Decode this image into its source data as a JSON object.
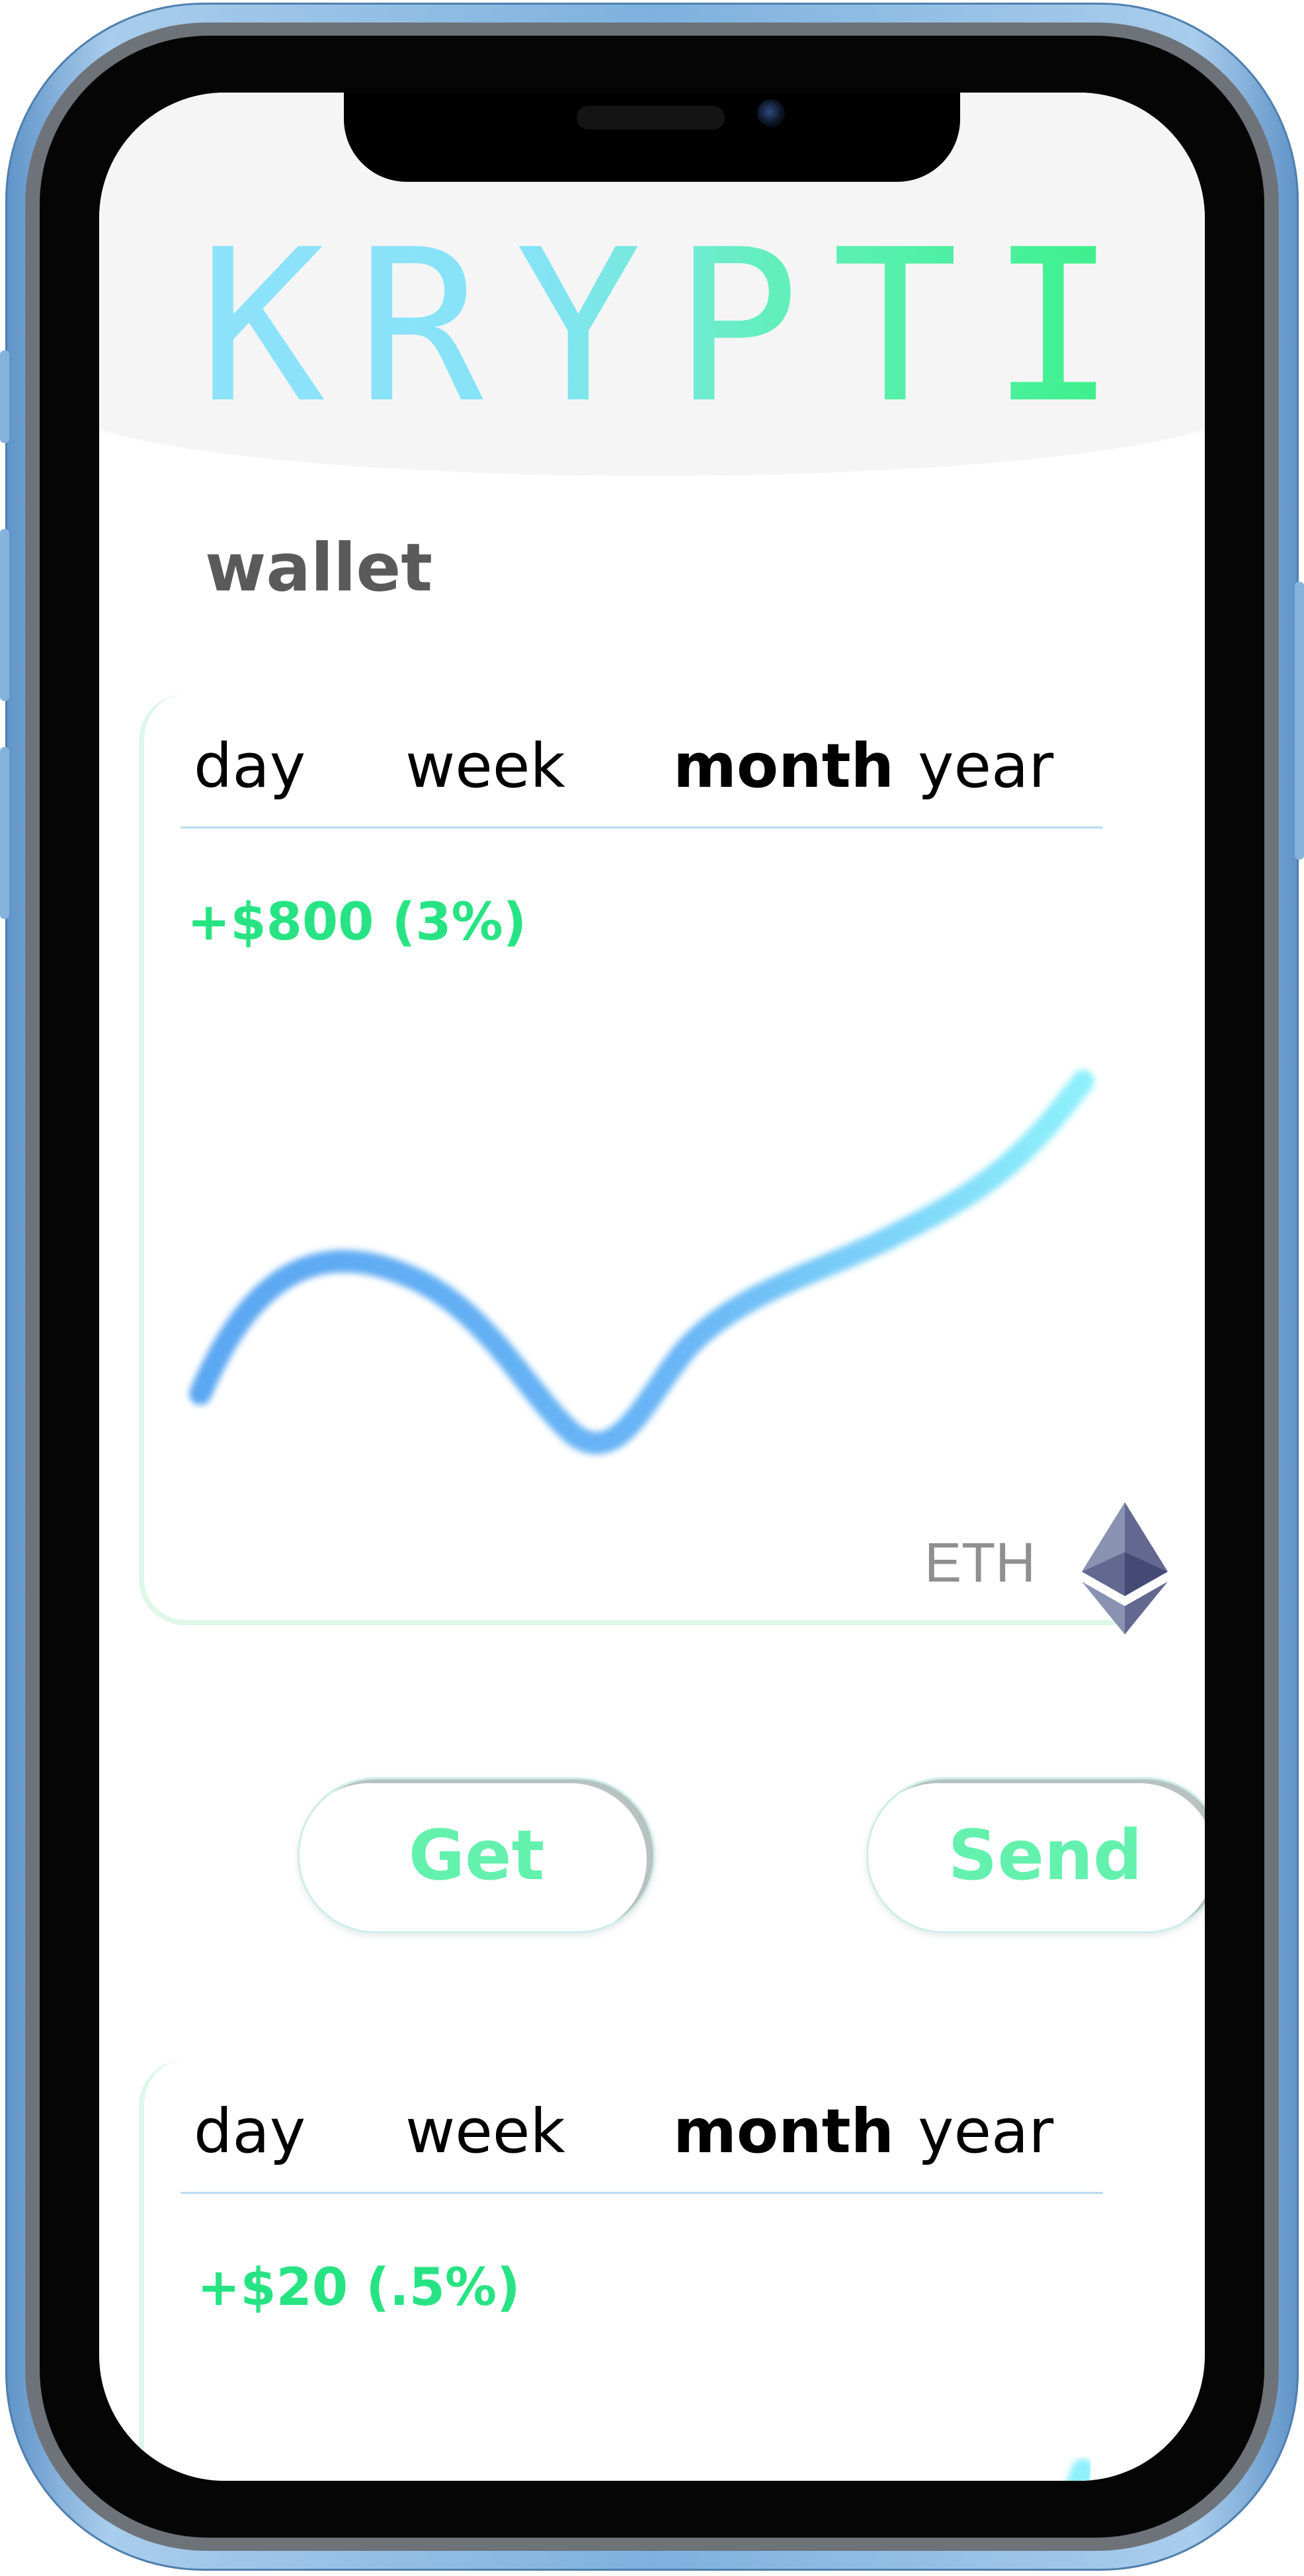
{
  "app": {
    "logo": "KRYPTIK",
    "section_title": "wallet"
  },
  "wallet_card": {
    "tabs": [
      {
        "label": "day",
        "active": false
      },
      {
        "label": "week",
        "active": false
      },
      {
        "label": "month",
        "active": true
      },
      {
        "label": "year",
        "active": false
      }
    ],
    "change": "+$800 (3%)",
    "asset_label": "ETH",
    "asset_icon": "ethereum-icon"
  },
  "actions": {
    "get_label": "Get",
    "send_label": "Send"
  },
  "second_card": {
    "tabs": [
      {
        "label": "day",
        "active": false
      },
      {
        "label": "week",
        "active": false
      },
      {
        "label": "month",
        "active": true
      },
      {
        "label": "year",
        "active": false
      }
    ],
    "change": "+$20 (.5%)"
  },
  "colors": {
    "accent_green": "#28e383",
    "button_text": "#63f1ad",
    "line_start": "#5aa7f2",
    "line_end": "#8ef0fb",
    "frame_blue": "#7eb1de"
  }
}
